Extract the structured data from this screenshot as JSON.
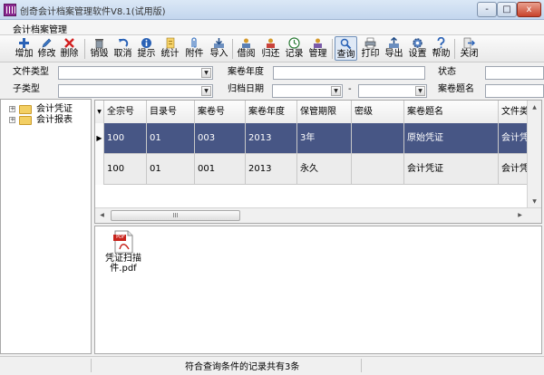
{
  "window": {
    "title": "创奇会计档案管理软件V8.1(试用版)",
    "minimize_label": "-",
    "maximize_label": "□",
    "close_label": "x"
  },
  "menu": {
    "items": [
      "会计档案管理"
    ]
  },
  "toolbar": {
    "buttons": [
      {
        "label": "增加",
        "icon": "add-icon"
      },
      {
        "label": "修改",
        "icon": "edit-icon"
      },
      {
        "label": "删除",
        "icon": "delete-icon"
      },
      {
        "label": "销毁",
        "icon": "trash-icon"
      },
      {
        "label": "取消",
        "icon": "undo-icon"
      },
      {
        "label": "提示",
        "icon": "info-icon"
      },
      {
        "label": "统计",
        "icon": "statistics-icon"
      },
      {
        "label": "附件",
        "icon": "paperclip-icon"
      },
      {
        "label": "导入",
        "icon": "import-icon"
      },
      {
        "label": "借阅",
        "icon": "borrow-icon"
      },
      {
        "label": "归还",
        "icon": "return-icon"
      },
      {
        "label": "记录",
        "icon": "clock-icon"
      },
      {
        "label": "管理",
        "icon": "manage-icon"
      },
      {
        "label": "查询",
        "icon": "search-icon",
        "active": true
      },
      {
        "label": "打印",
        "icon": "printer-icon"
      },
      {
        "label": "导出",
        "icon": "export-icon"
      },
      {
        "label": "设置",
        "icon": "gear-icon"
      },
      {
        "label": "帮助",
        "icon": "help-icon"
      },
      {
        "label": "关闭",
        "icon": "exit-icon"
      }
    ]
  },
  "filters": {
    "file_type": {
      "label": "文件类型",
      "value": ""
    },
    "sub_type": {
      "label": "子类型",
      "value": ""
    },
    "year": {
      "label": "案卷年度",
      "value": ""
    },
    "archive_date": {
      "label": "归档日期",
      "from": "",
      "to": "",
      "separator": "-"
    },
    "status": {
      "label": "状态",
      "value": ""
    },
    "title": {
      "label": "案卷题名",
      "value": ""
    }
  },
  "tree": {
    "nodes": [
      {
        "label": "会计凭证",
        "expander": "+"
      },
      {
        "label": "会计报表",
        "expander": "+"
      }
    ]
  },
  "table": {
    "corner_label": "▼",
    "columns": [
      "全宗号",
      "目录号",
      "案卷号",
      "案卷年度",
      "保管期限",
      "密级",
      "案卷题名",
      "文件类"
    ],
    "rows": [
      [
        "100",
        "01",
        "003",
        "2013",
        "3年",
        "",
        "原始凭证",
        "会计凭"
      ],
      [
        "100",
        "01",
        "001",
        "2013",
        "永久",
        "",
        "会计凭证",
        "会计凭"
      ]
    ],
    "row_indicator": "▶",
    "hscroll_thumb": "III"
  },
  "attachments": {
    "files": [
      {
        "name": "凭证扫描件.pdf",
        "badge": "PDF",
        "icon": "pdf-file-icon"
      }
    ]
  },
  "status_bar": {
    "text": "符合查询条件的记录共有3条"
  },
  "colors": {
    "selected_row": "#475685",
    "title_bar": "#c3d6ee"
  }
}
